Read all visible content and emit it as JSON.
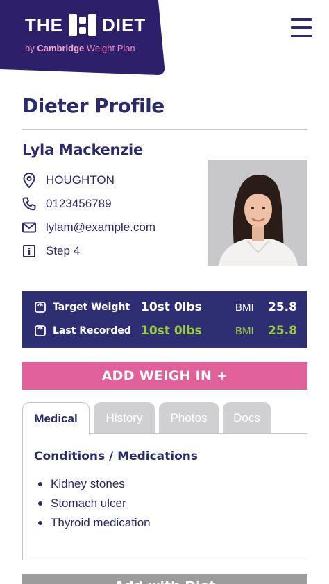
{
  "brand": {
    "logo_left": "THE",
    "logo_right": "DIET",
    "logo_sub_prefix": "by",
    "logo_sub_brand": "Cambridge",
    "logo_sub_suffix": "Weight Plan",
    "bg_color": "#2e1f6b"
  },
  "page": {
    "title": "Dieter Profile"
  },
  "dieter": {
    "name": "Lyla Mackenzie",
    "location": "HOUGHTON",
    "phone": "0123456789",
    "email": "lylam@example.com",
    "step": "Step 4",
    "icons": {
      "location": "map-pin-icon",
      "phone": "phone-icon",
      "email": "envelope-icon",
      "step": "info-icon"
    }
  },
  "weights": {
    "target": {
      "label": "Target Weight",
      "value": "10st 0lbs",
      "bmi_label": "BMI",
      "bmi_value": "25.8"
    },
    "recorded": {
      "label": "Last Recorded",
      "value": "10st 0lbs",
      "bmi_label": "BMI",
      "bmi_value": "25.8"
    },
    "panel_color": "#2e2f73",
    "accent_green": "#9ccc3c"
  },
  "actions": {
    "add_weigh_in": "ADD WEIGH IN +",
    "bottom_button": "Add with Diet",
    "accent_pink": "#e0609a"
  },
  "tabs": [
    {
      "label": "Medical",
      "active": true
    },
    {
      "label": "History",
      "active": false
    },
    {
      "label": "Photos",
      "active": false
    },
    {
      "label": "Docs",
      "active": false
    }
  ],
  "medical": {
    "heading": "Conditions / Medications",
    "items": [
      "Kidney stones",
      "Stomach ulcer",
      "Thyroid medication"
    ]
  }
}
